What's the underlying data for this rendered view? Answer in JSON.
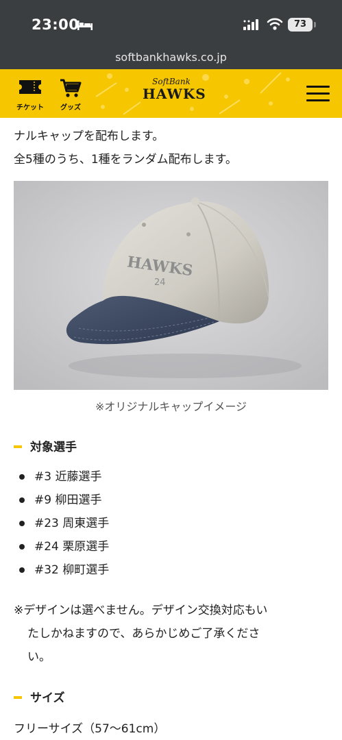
{
  "status_bar": {
    "time": "23:00",
    "battery": "73",
    "icons": [
      "bed-icon",
      "signal-icon",
      "wifi-icon",
      "battery-icon"
    ]
  },
  "browser": {
    "url": "softbankhawks.co.jp"
  },
  "header": {
    "ticket_label": "チケット",
    "goods_label": "グッズ",
    "logo_top": "SoftBank",
    "logo_main": "HAWKS",
    "icons": [
      "ticket-icon",
      "cart-icon",
      "hamburger-menu-icon"
    ],
    "colors": {
      "header_bg": "#f6c600",
      "status_bg": "#3b3e40"
    }
  },
  "content": {
    "intro_line1": "ナルキャップを配布します。",
    "intro_line2": "全5種のうち、1種をランダム配布します。",
    "image_caption": "※オリジナルキャップイメージ",
    "image_alt_emblem": "HAWKS 24",
    "section_players_title": "対象選手",
    "players": [
      "#3 近藤選手",
      "#9 柳田選手",
      "#23 周東選手",
      "#24 栗原選手",
      "#32 柳町選手"
    ],
    "note_line1": "※デザインは選べません。デザイン交換対応もい",
    "note_line2": "たしかねますので、あらかじめご了承くださ",
    "note_line3": "い。",
    "section_size_title": "サイズ",
    "size_text": "フリーサイズ（57〜61cm）"
  }
}
